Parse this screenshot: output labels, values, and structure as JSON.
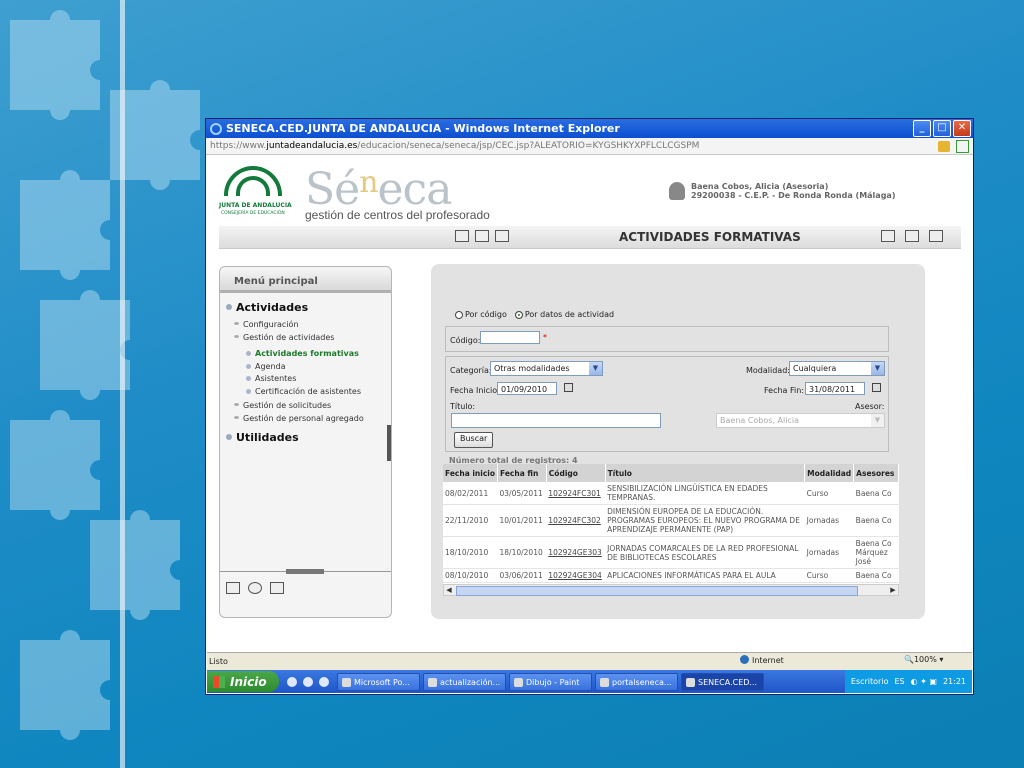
{
  "window": {
    "title": "SENECA.CED.JUNTA DE ANDALUCIA - Windows Internet Explorer",
    "address_prefix": "https://www.",
    "address_domain": "juntadeandalucia.es",
    "address_path": "/educacion/seneca/seneca/jsp/CEC.jsp?ALEATORIO=KYGSHKYXPFLCLCGSPM"
  },
  "header": {
    "org_line1": "JUNTA DE ANDALUCIA",
    "org_line2": "CONSEJERÍA DE EDUCACIÓN",
    "logo_pre": "Sé",
    "logo_n": "n",
    "logo_post": "eca",
    "subtitle": "gestión de centros del profesorado",
    "user_line1": "Baena Cobos, Alicia (Asesoria)",
    "user_line2": "29200038 - C.E.P. - De Ronda  Ronda (Málaga)"
  },
  "navbar": {
    "title": "ACTIVIDADES FORMATIVAS"
  },
  "menu": {
    "header": "Menú principal",
    "actividades": "Actividades",
    "configuracion": "Configuración",
    "gestion_actividades": "Gestión de actividades",
    "actividades_formativas": "Actividades formativas",
    "agenda": "Agenda",
    "asistentes": "Asistentes",
    "certificacion": "Certificación de asistentes",
    "gestion_solicitudes": "Gestión de solicitudes",
    "gestion_personal": "Gestión de personal agregado",
    "utilidades": "Utilidades"
  },
  "form": {
    "radio_codigo": "Por código",
    "radio_datos": "Por datos de actividad",
    "codigo_label": "Código:",
    "categoria_label": "Categoría:",
    "categoria_value": "Otras modalidades",
    "modalidad_label": "Modalidad:",
    "modalidad_value": "Cualquiera",
    "fecha_inicio_label": "Fecha Inicio:",
    "fecha_inicio_value": "01/09/2010",
    "fecha_fin_label": "Fecha Fin:",
    "fecha_fin_value": "31/08/2011",
    "titulo_label": "Título:",
    "asesor_label": "Asesor:",
    "asesor_value": "Baena Cobos, Alicia",
    "buscar": "Buscar",
    "count": "Número total de registros: 4"
  },
  "table": {
    "headers": [
      "Fecha inicio",
      "Fecha fin",
      "Código",
      "Título",
      "Modalidad",
      "Asesores"
    ],
    "rows": [
      {
        "inicio": "08/02/2011",
        "fin": "03/05/2011",
        "codigo": "102924FC301",
        "titulo": "SENSIBILIZACIÓN LINGÜÍSTICA EN EDADES TEMPRANAS.",
        "modalidad": "Curso",
        "asesor": "Baena Co"
      },
      {
        "inicio": "22/11/2010",
        "fin": "10/01/2011",
        "codigo": "102924FC302",
        "titulo": "DIMENSIÓN EUROPEA DE LA EDUCACIÓN. PROGRAMAS EUROPEOS: EL NUEVO PROGRAMA DE APRENDIZAJE PERMANENTE (PAP)",
        "modalidad": "Jornadas",
        "asesor": "Baena Co"
      },
      {
        "inicio": "18/10/2010",
        "fin": "18/10/2010",
        "codigo": "102924GE303",
        "titulo": "JORNADAS COMARCALES DE LA RED PROFESIONAL DE BIBLIOTECAS ESCOLARES",
        "modalidad": "Jornadas",
        "asesor": "Baena Co Márquez José"
      },
      {
        "inicio": "08/10/2010",
        "fin": "03/06/2011",
        "codigo": "102924GE304",
        "titulo": "APLICACIONES INFORMÁTICAS PARA EL AULA",
        "modalidad": "Curso",
        "asesor": "Baena Co"
      }
    ]
  },
  "statusbar": {
    "text": "Listo",
    "zone": "Internet",
    "zoom": "100%"
  },
  "taskbar": {
    "start": "Inicio",
    "tasks": [
      "Microsoft Po...",
      "actualización...",
      "Dibujo - Paint",
      "portalseneca...",
      "SENECA.CED..."
    ],
    "escritorio": "Escritorio",
    "lang": "ES",
    "clock": "21:21"
  }
}
